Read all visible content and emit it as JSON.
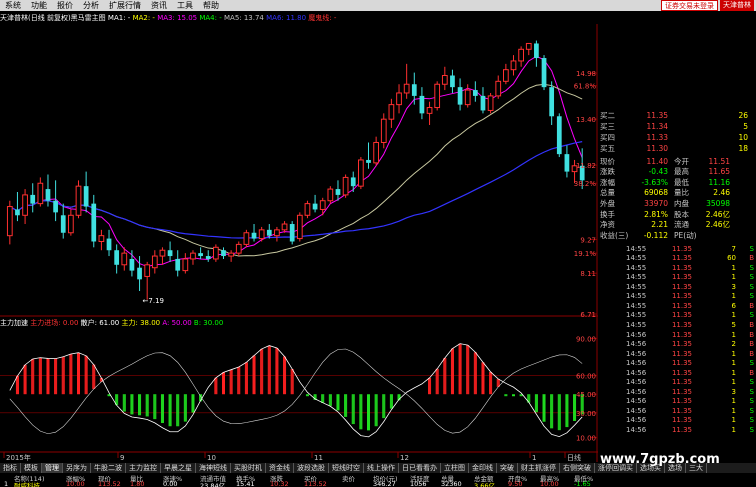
{
  "menu": {
    "items": [
      "系统",
      "功能",
      "报价",
      "分析",
      "扩展行情",
      "资讯",
      "工具",
      "帮助"
    ],
    "login": "证券交易未登录",
    "broker": "天津普林"
  },
  "ma_legend": {
    "title": "天津普林(日线 前复权)黑马雷主图",
    "ma1": "MA1: -",
    "ma2": "MA2: -",
    "ma3": "MA3: 15.05",
    "ma4": "MA4: -",
    "ma5": "MA5: 13.74",
    "ma6": "MA6: 11.80",
    "extra": "魔鬼线: -",
    "colors": {
      "ma1": "#ffffff",
      "ma2": "#ffff00",
      "ma3": "#ff00ff",
      "ma4": "#00ff00",
      "ma5": "#c0c0c0",
      "ma6": "#3333ff",
      "extra": "#ff0000"
    }
  },
  "price_axis": {
    "labels": [
      "14.98",
      "61.8%",
      "13.40",
      "11.82",
      "38.2%",
      "9.27",
      "19.1%",
      "8.11",
      "6.71"
    ]
  },
  "candles": [
    [
      9.4,
      10.6,
      9.1,
      10.4
    ],
    [
      10.3,
      10.9,
      9.9,
      10.1
    ],
    [
      10.1,
      11.0,
      9.8,
      10.8
    ],
    [
      10.8,
      11.2,
      10.2,
      10.5
    ],
    [
      10.5,
      11.4,
      10.4,
      11.2
    ],
    [
      11.0,
      11.5,
      10.4,
      10.6
    ],
    [
      10.6,
      11.3,
      9.9,
      10.2
    ],
    [
      10.1,
      10.5,
      9.3,
      9.5
    ],
    [
      9.5,
      10.3,
      9.4,
      10.1
    ],
    [
      10.1,
      11.3,
      10.0,
      11.1
    ],
    [
      11.1,
      11.6,
      10.2,
      10.4
    ],
    [
      10.5,
      10.8,
      9.0,
      9.2
    ],
    [
      9.2,
      9.6,
      8.9,
      9.4
    ],
    [
      9.3,
      9.6,
      8.7,
      8.9
    ],
    [
      8.9,
      9.1,
      8.1,
      8.4
    ],
    [
      8.4,
      9.0,
      8.2,
      8.8
    ],
    [
      8.6,
      8.9,
      8.0,
      8.2
    ],
    [
      8.3,
      8.7,
      7.5,
      7.9
    ],
    [
      8.0,
      8.5,
      7.2,
      8.4
    ],
    [
      8.3,
      8.9,
      8.1,
      8.7
    ],
    [
      8.7,
      9.0,
      8.4,
      8.9
    ],
    [
      8.9,
      9.2,
      8.5,
      8.7
    ],
    [
      8.6,
      8.9,
      8.0,
      8.2
    ],
    [
      8.2,
      8.8,
      8.1,
      8.6
    ],
    [
      8.6,
      8.9,
      8.4,
      8.8
    ],
    [
      8.8,
      9.0,
      8.6,
      8.7
    ],
    [
      8.7,
      8.9,
      8.5,
      8.6
    ],
    [
      8.6,
      9.1,
      8.5,
      9.0
    ],
    [
      8.9,
      9.0,
      8.6,
      8.7
    ],
    [
      8.7,
      8.9,
      8.5,
      8.8
    ],
    [
      8.8,
      9.2,
      8.7,
      9.1
    ],
    [
      9.1,
      9.6,
      9.0,
      9.5
    ],
    [
      9.5,
      9.8,
      9.2,
      9.3
    ],
    [
      9.3,
      9.7,
      9.2,
      9.6
    ],
    [
      9.6,
      9.8,
      9.3,
      9.4
    ],
    [
      9.4,
      9.7,
      9.2,
      9.6
    ],
    [
      9.6,
      9.9,
      9.5,
      9.8
    ],
    [
      9.8,
      9.9,
      9.1,
      9.2
    ],
    [
      9.3,
      10.2,
      9.2,
      10.1
    ],
    [
      10.1,
      10.6,
      10.0,
      10.5
    ],
    [
      10.5,
      10.8,
      10.2,
      10.3
    ],
    [
      10.3,
      10.7,
      10.1,
      10.6
    ],
    [
      10.6,
      11.1,
      10.5,
      11.0
    ],
    [
      11.0,
      11.3,
      10.6,
      10.8
    ],
    [
      10.8,
      11.5,
      10.7,
      11.4
    ],
    [
      11.4,
      11.6,
      10.9,
      11.1
    ],
    [
      11.1,
      12.1,
      11.0,
      12.0
    ],
    [
      12.0,
      12.6,
      11.7,
      11.9
    ],
    [
      11.9,
      12.8,
      11.8,
      12.6
    ],
    [
      12.6,
      13.6,
      12.4,
      13.4
    ],
    [
      13.4,
      14.1,
      13.1,
      13.9
    ],
    [
      13.9,
      14.6,
      13.6,
      14.3
    ],
    [
      14.3,
      15.3,
      14.1,
      14.6
    ],
    [
      14.6,
      15.0,
      13.9,
      14.2
    ],
    [
      14.2,
      14.5,
      13.4,
      13.6
    ],
    [
      13.6,
      14.0,
      13.2,
      13.8
    ],
    [
      13.8,
      14.7,
      13.7,
      14.6
    ],
    [
      14.6,
      15.2,
      14.4,
      14.9
    ],
    [
      14.9,
      15.1,
      14.3,
      14.5
    ],
    [
      14.5,
      14.8,
      13.7,
      13.9
    ],
    [
      13.9,
      14.6,
      13.8,
      14.4
    ],
    [
      14.4,
      14.7,
      14.0,
      14.2
    ],
    [
      14.2,
      14.5,
      13.6,
      13.7
    ],
    [
      13.7,
      14.3,
      13.6,
      14.2
    ],
    [
      14.2,
      14.9,
      14.1,
      14.7
    ],
    [
      14.7,
      15.3,
      14.6,
      15.1
    ],
    [
      15.1,
      15.6,
      14.9,
      15.4
    ],
    [
      15.4,
      15.9,
      15.2,
      15.8
    ],
    [
      15.8,
      16.0,
      15.6,
      16.0
    ],
    [
      16.0,
      16.1,
      15.2,
      15.5
    ],
    [
      15.5,
      15.6,
      14.4,
      14.5
    ],
    [
      14.5,
      14.7,
      13.2,
      13.5
    ],
    [
      13.5,
      13.6,
      12.1,
      12.2
    ],
    [
      12.2,
      12.5,
      11.4,
      11.6
    ],
    [
      11.6,
      12.0,
      11.2,
      11.8
    ],
    [
      11.8,
      12.4,
      11.0,
      11.3
    ]
  ],
  "annotations": {
    "low": "←7.19"
  },
  "indicator": {
    "title": "主力加速",
    "series1": "主力进场: 0.00",
    "series2": "散户: 61.00",
    "series3": "主力: 38.00",
    "series4": "A: 50.00",
    "series5": "B: 30.00",
    "axis": [
      "90.00",
      "60.00",
      "45.00",
      "30.00",
      "10.00"
    ]
  },
  "date_axis": {
    "labels": [
      "2015年",
      "9",
      "10",
      "11",
      "12",
      "1",
      "日线"
    ]
  },
  "quote": {
    "rows": [
      {
        "l": "买二",
        "v": "11.35",
        "v2": "26",
        "c": "#ff4444"
      },
      {
        "l": "买三",
        "v": "11.34",
        "v2": "5",
        "c": "#ff4444"
      },
      {
        "l": "买四",
        "v": "11.33",
        "v2": "10",
        "c": "#ff4444"
      },
      {
        "l": "买五",
        "v": "11.30",
        "v2": "18",
        "c": "#ff4444"
      }
    ],
    "stats": [
      {
        "l": "现价",
        "v": "11.40",
        "c": "#ff4444",
        "l2": "今开",
        "v2": "11.51",
        "c2": "#ff4444"
      },
      {
        "l": "涨跌",
        "v": "-0.43",
        "c": "#00ff00",
        "l2": "最高",
        "v2": "11.65",
        "c2": "#ff4444"
      },
      {
        "l": "涨幅",
        "v": "-3.63%",
        "c": "#00ff00",
        "l2": "最低",
        "v2": "11.16",
        "c2": "#00ff00"
      },
      {
        "l": "总量",
        "v": "69068",
        "c": "#ffff00",
        "l2": "量比",
        "v2": "2.46",
        "c2": "#ffff00"
      },
      {
        "l": "外盘",
        "v": "33970",
        "c": "#ff4444",
        "l2": "内盘",
        "v2": "35098",
        "c2": "#00ff00"
      },
      {
        "l": "换手",
        "v": "2.81%",
        "c": "#ffff00",
        "l2": "股本",
        "v2": "2.46亿",
        "c2": "#ffff00"
      },
      {
        "l": "净资",
        "v": "2.21",
        "c": "#ffff00",
        "l2": "流通",
        "v2": "2.46亿",
        "c2": "#ffff00"
      },
      {
        "l": "收益(三)",
        "v": "-0.112",
        "c": "#ffff00",
        "l2": "PE(动)",
        "v2": "",
        "c2": "#ffff00"
      }
    ],
    "ticks": [
      {
        "t": "14:55",
        "p": "11.35",
        "vol": "7",
        "d": "S",
        "dc": "#00ff00"
      },
      {
        "t": "14:55",
        "p": "11.35",
        "vol": "60",
        "d": "B",
        "dc": "#ff4444"
      },
      {
        "t": "14:55",
        "p": "11.35",
        "vol": "1",
        "d": "S",
        "dc": "#00ff00"
      },
      {
        "t": "14:55",
        "p": "11.35",
        "vol": "1",
        "d": "S",
        "dc": "#00ff00"
      },
      {
        "t": "14:55",
        "p": "11.35",
        "vol": "3",
        "d": "S",
        "dc": "#00ff00"
      },
      {
        "t": "14:55",
        "p": "11.35",
        "vol": "1",
        "d": "S",
        "dc": "#00ff00"
      },
      {
        "t": "14:55",
        "p": "11.35",
        "vol": "6",
        "d": "B",
        "dc": "#ff4444"
      },
      {
        "t": "14:55",
        "p": "11.35",
        "vol": "1",
        "d": "S",
        "dc": "#00ff00"
      },
      {
        "t": "14:55",
        "p": "11.35",
        "vol": "5",
        "d": "B",
        "dc": "#ff4444"
      },
      {
        "t": "14:56",
        "p": "11.35",
        "vol": "1",
        "d": "B",
        "dc": "#ff4444"
      },
      {
        "t": "14:56",
        "p": "11.35",
        "vol": "2",
        "d": "B",
        "dc": "#ff4444"
      },
      {
        "t": "14:56",
        "p": "11.35",
        "vol": "1",
        "d": "B",
        "dc": "#ff4444"
      },
      {
        "t": "14:56",
        "p": "11.35",
        "vol": "1",
        "d": "S",
        "dc": "#00ff00"
      },
      {
        "t": "14:56",
        "p": "11.35",
        "vol": "1",
        "d": "B",
        "dc": "#ff4444"
      },
      {
        "t": "14:56",
        "p": "11.35",
        "vol": "1",
        "d": "S",
        "dc": "#00ff00"
      },
      {
        "t": "14:56",
        "p": "11.35",
        "vol": "3",
        "d": "S",
        "dc": "#00ff00"
      },
      {
        "t": "14:56",
        "p": "11.35",
        "vol": "1",
        "d": "S",
        "dc": "#00ff00"
      },
      {
        "t": "14:56",
        "p": "11.35",
        "vol": "1",
        "d": "S",
        "dc": "#00ff00"
      },
      {
        "t": "14:56",
        "p": "11.35",
        "vol": "1",
        "d": "S",
        "dc": "#00ff00"
      },
      {
        "t": "14:56",
        "p": "11.35",
        "vol": "1",
        "d": "S",
        "dc": "#00ff00"
      }
    ]
  },
  "tabs": [
    "指标",
    "模板",
    "管理",
    "另序为",
    "牛股二波",
    "主力监控",
    "早晨之星",
    "海神短线",
    "买股时机",
    "资金线",
    "波段选股",
    "短线时空",
    "线上操作",
    "日已看看办",
    "立柱图",
    "金印线",
    "突破",
    "财主抓涨停",
    "右侧突破",
    "涨停回调买",
    "选场买",
    "选场",
    "三大"
  ],
  "table": {
    "headers": [
      "名称(114)",
      "涨幅%",
      "现价",
      "量比",
      "涨速%",
      "流通市值",
      "换手%",
      "涨跌",
      "买价",
      "卖价",
      "均价(元)",
      "活跃度",
      "总量",
      "总金额",
      "开盘%",
      "最高%",
      "最低%"
    ],
    "row": [
      "1",
      "耐威科技",
      "10.00",
      "113.52",
      "1.80",
      "0.00",
      "23.84亿",
      "15.41",
      "10.32",
      "113.52",
      "346.27",
      "1056",
      "32360",
      "3.66亿",
      "9.50",
      "10.00",
      "-1.65"
    ]
  },
  "watermark": "www.7gpzb.com"
}
